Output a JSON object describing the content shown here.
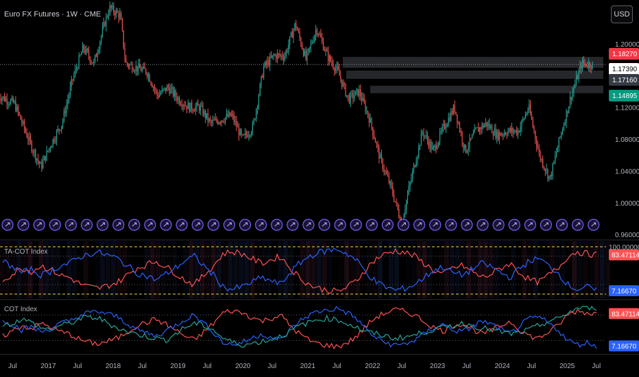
{
  "header": {
    "title": "Euro FX Futures · 1W · CME",
    "currency_button": "USD"
  },
  "colors": {
    "up": "#26a69a",
    "down": "#ef5350",
    "cot_red": "#ff5252",
    "cot_blue": "#2962ff",
    "cot_teal": "#26a69a",
    "price_label_red": "#f23645",
    "price_label_green": "#089981",
    "dashed_yellow": "#f5d742",
    "event_icon": "#7b61ff"
  },
  "chart_data": [
    {
      "type": "candlestick",
      "title": "Euro FX Futures · 1W · CME",
      "x_ticks": [
        "Jul",
        "2017",
        "Jul",
        "2018",
        "Jul",
        "2019",
        "Jul",
        "2020",
        "Jul",
        "2021",
        "Jul",
        "2022",
        "Jul",
        "2023",
        "Jul",
        "2024",
        "Jul",
        "2025",
        "Jul"
      ],
      "y_ticks": [
        "1.20000",
        "1.16000",
        "1.12000",
        "1.08000",
        "1.04000",
        "1.00000",
        "0.96000"
      ],
      "ylim": [
        0.955,
        1.255
      ],
      "price_labels": [
        {
          "text": "1.18270",
          "style": "red"
        },
        {
          "text": "1.17390",
          "style": "white"
        },
        {
          "text": "1.17160",
          "style": "gray"
        },
        {
          "text": "1.14895",
          "style": "green"
        }
      ],
      "path_points": [
        [
          "2016-05",
          1.135
        ],
        [
          "2016-08",
          1.125
        ],
        [
          "2016-11",
          1.075
        ],
        [
          "2017-01",
          1.045
        ],
        [
          "2017-03",
          1.075
        ],
        [
          "2017-05",
          1.1
        ],
        [
          "2017-07",
          1.155
        ],
        [
          "2017-09",
          1.195
        ],
        [
          "2017-11",
          1.175
        ],
        [
          "2018-01",
          1.225
        ],
        [
          "2018-02",
          1.245
        ],
        [
          "2018-04",
          1.235
        ],
        [
          "2018-05",
          1.175
        ],
        [
          "2018-07",
          1.17
        ],
        [
          "2018-09",
          1.165
        ],
        [
          "2018-11",
          1.135
        ],
        [
          "2019-01",
          1.145
        ],
        [
          "2019-03",
          1.13
        ],
        [
          "2019-05",
          1.12
        ],
        [
          "2019-07",
          1.12
        ],
        [
          "2019-09",
          1.1
        ],
        [
          "2019-11",
          1.105
        ],
        [
          "2020-01",
          1.11
        ],
        [
          "2020-03",
          1.08
        ],
        [
          "2020-05",
          1.095
        ],
        [
          "2020-07",
          1.17
        ],
        [
          "2020-09",
          1.185
        ],
        [
          "2020-11",
          1.185
        ],
        [
          "2021-01",
          1.225
        ],
        [
          "2021-03",
          1.18
        ],
        [
          "2021-05",
          1.22
        ],
        [
          "2021-07",
          1.185
        ],
        [
          "2021-09",
          1.165
        ],
        [
          "2021-11",
          1.13
        ],
        [
          "2022-01",
          1.14
        ],
        [
          "2022-03",
          1.105
        ],
        [
          "2022-05",
          1.055
        ],
        [
          "2022-07",
          1.02
        ],
        [
          "2022-09",
          0.975
        ],
        [
          "2022-11",
          1.035
        ],
        [
          "2023-01",
          1.09
        ],
        [
          "2023-03",
          1.065
        ],
        [
          "2023-05",
          1.095
        ],
        [
          "2023-07",
          1.12
        ],
        [
          "2023-09",
          1.065
        ],
        [
          "2023-11",
          1.09
        ],
        [
          "2024-01",
          1.1
        ],
        [
          "2024-03",
          1.085
        ],
        [
          "2024-05",
          1.09
        ],
        [
          "2024-07",
          1.09
        ],
        [
          "2024-09",
          1.12
        ],
        [
          "2024-11",
          1.06
        ],
        [
          "2025-01",
          1.03
        ],
        [
          "2025-03",
          1.085
        ],
        [
          "2025-05",
          1.135
        ],
        [
          "2025-07",
          1.175
        ],
        [
          "2025-09",
          1.174
        ]
      ],
      "event_icon_count": 38
    },
    {
      "type": "line",
      "title": "TA-COT Index",
      "y_ticks": [
        "100.00000"
      ],
      "ylim": [
        0,
        100
      ],
      "value_labels": [
        {
          "text": "83.47114",
          "color": "red"
        },
        {
          "text": "7.16670",
          "color": "blue"
        }
      ],
      "series": [
        {
          "color": "red",
          "values": [
            30,
            42,
            55,
            48,
            60,
            52,
            40,
            35,
            22,
            15,
            12,
            18,
            25,
            40,
            55,
            62,
            70,
            58,
            45,
            30,
            20,
            40,
            60,
            85,
            90,
            85,
            75,
            65,
            72,
            80,
            55,
            35,
            20,
            12,
            8,
            5,
            15,
            30,
            55,
            75,
            85,
            92,
            88,
            80,
            65,
            50,
            42,
            55,
            60,
            48,
            35,
            42,
            55,
            65,
            45,
            30,
            25,
            40,
            55,
            80,
            90,
            85,
            83
          ]
        },
        {
          "color": "blue",
          "values": [
            70,
            58,
            45,
            52,
            40,
            48,
            60,
            65,
            78,
            85,
            88,
            82,
            75,
            60,
            45,
            38,
            30,
            42,
            55,
            70,
            80,
            60,
            40,
            15,
            10,
            15,
            25,
            35,
            28,
            20,
            45,
            65,
            80,
            88,
            92,
            95,
            85,
            70,
            45,
            25,
            15,
            8,
            12,
            20,
            35,
            50,
            58,
            45,
            40,
            52,
            65,
            58,
            45,
            35,
            55,
            70,
            75,
            60,
            45,
            20,
            10,
            15,
            7
          ]
        }
      ]
    },
    {
      "type": "line",
      "title": "COT Index",
      "value_labels": [
        {
          "text": "83.47114",
          "color": "red"
        },
        {
          "text": "7.16670",
          "color": "blue"
        }
      ],
      "series": [
        {
          "color": "red",
          "values": [
            30,
            42,
            55,
            48,
            60,
            52,
            40,
            35,
            22,
            15,
            12,
            18,
            25,
            40,
            55,
            62,
            70,
            58,
            45,
            30,
            20,
            40,
            60,
            85,
            90,
            85,
            75,
            65,
            72,
            80,
            55,
            35,
            20,
            12,
            8,
            5,
            15,
            30,
            55,
            75,
            85,
            92,
            88,
            80,
            65,
            50,
            42,
            55,
            60,
            48,
            35,
            42,
            55,
            65,
            45,
            30,
            25,
            40,
            55,
            80,
            90,
            85,
            83
          ]
        },
        {
          "color": "blue",
          "values": [
            70,
            58,
            45,
            52,
            40,
            48,
            60,
            65,
            78,
            85,
            88,
            82,
            75,
            60,
            45,
            38,
            30,
            42,
            55,
            70,
            80,
            60,
            40,
            15,
            10,
            15,
            25,
            35,
            28,
            20,
            45,
            65,
            80,
            88,
            92,
            95,
            85,
            70,
            45,
            25,
            15,
            8,
            12,
            20,
            35,
            50,
            58,
            45,
            40,
            52,
            65,
            58,
            45,
            35,
            55,
            70,
            75,
            60,
            45,
            20,
            10,
            15,
            7
          ]
        },
        {
          "color": "teal",
          "values": [
            55,
            60,
            70,
            62,
            50,
            45,
            55,
            60,
            70,
            75,
            72,
            60,
            50,
            40,
            35,
            30,
            25,
            20,
            35,
            50,
            60,
            55,
            45,
            25,
            15,
            10,
            12,
            18,
            22,
            30,
            40,
            55,
            62,
            70,
            72,
            68,
            60,
            50,
            40,
            35,
            30,
            25,
            28,
            32,
            40,
            45,
            50,
            55,
            60,
            55,
            50,
            45,
            40,
            35,
            38,
            45,
            55,
            65,
            70,
            85,
            95,
            98,
            97
          ]
        }
      ]
    }
  ]
}
